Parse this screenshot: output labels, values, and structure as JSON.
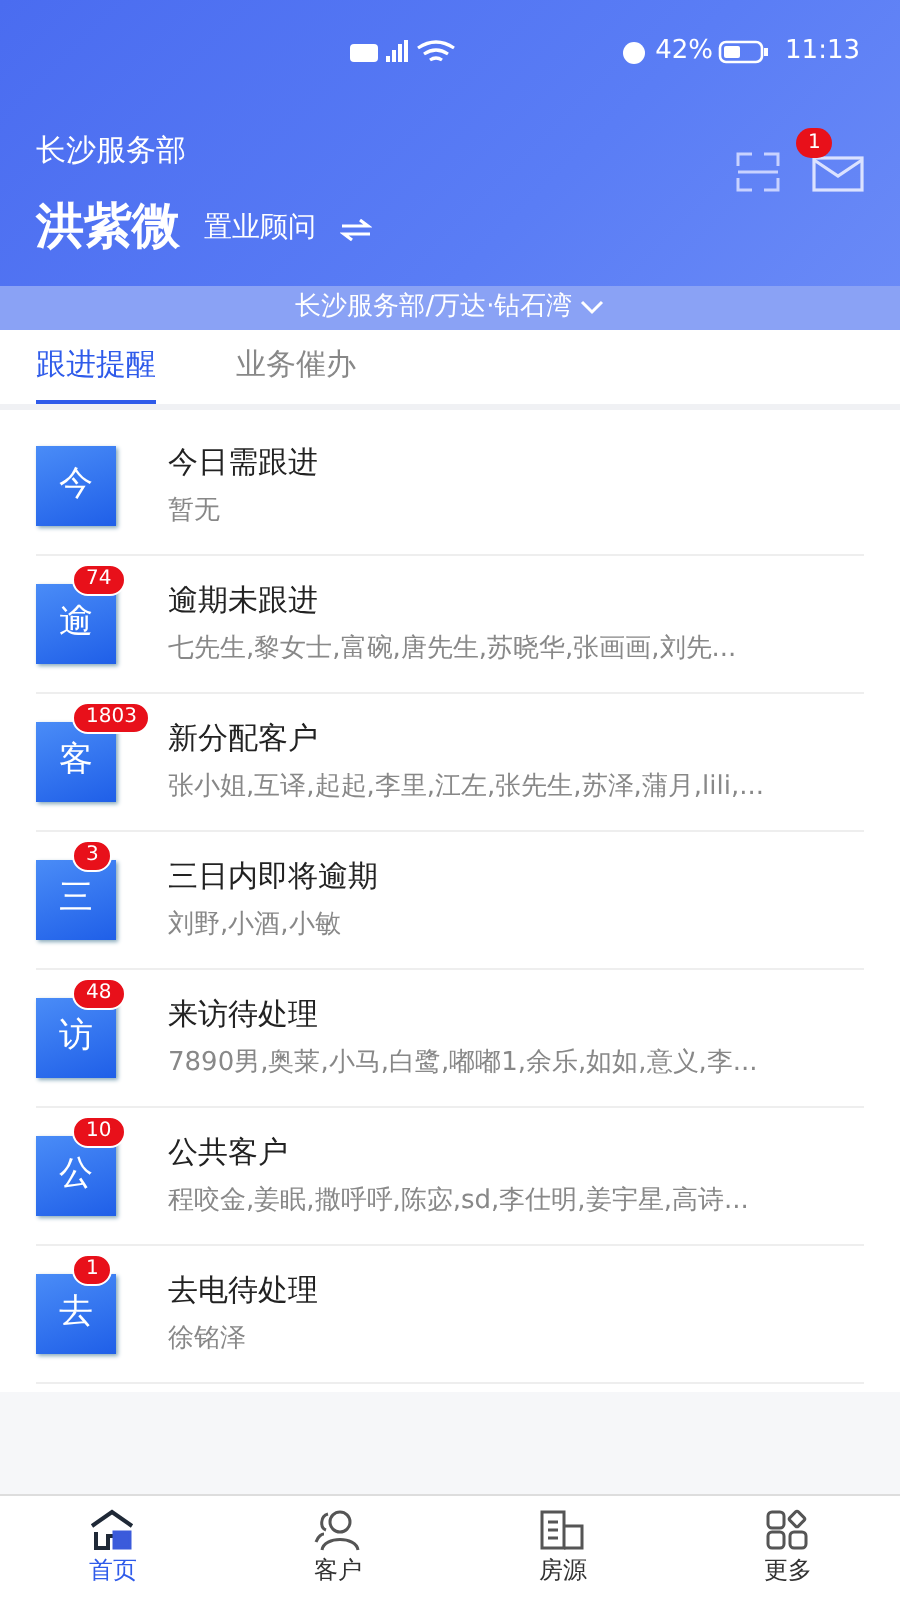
{
  "status_bar": {
    "battery": "42%",
    "time": "11:13"
  },
  "header": {
    "department": "长沙服务部",
    "name": "洪紫微",
    "role": "置业顾问",
    "message_badge": "1",
    "project": "长沙服务部/万达·钻石湾"
  },
  "tabs": [
    {
      "label": "跟进提醒",
      "selected": true
    },
    {
      "label": "业务催办",
      "selected": false
    }
  ],
  "reminders": [
    {
      "icon_char": "今",
      "title": "今日需跟进",
      "subtitle": "暂无"
    },
    {
      "icon_char": "逾",
      "badge": "74",
      "title": "逾期未跟进",
      "subtitle": "七先生,黎女士,富碗,唐先生,苏晓华,张画画,刘先..."
    },
    {
      "icon_char": "客",
      "badge": "1803",
      "title": "新分配客户",
      "subtitle": "张小姐,互译,起起,李里,江左,张先生,苏泽,蒲月,lili,..."
    },
    {
      "icon_char": "三",
      "badge": "3",
      "title": "三日内即将逾期",
      "subtitle": "刘野,小酒,小敏"
    },
    {
      "icon_char": "访",
      "badge": "48",
      "title": "来访待处理",
      "subtitle": "7890男,奥莱,小马,白鹭,嘟嘟1,余乐,如如,意义,李..."
    },
    {
      "icon_char": "公",
      "badge": "10",
      "title": "公共客户",
      "subtitle": "程咬金,姜眠,撒呼呼,陈宓,sd,李仕明,姜宇星,高诗..."
    },
    {
      "icon_char": "去",
      "badge": "1",
      "title": "去电待处理",
      "subtitle": "徐铭泽"
    }
  ],
  "bottom_nav": [
    {
      "kind": "home",
      "label": "首页",
      "selected": true
    },
    {
      "kind": "customers",
      "label": "客户",
      "selected": false
    },
    {
      "kind": "houses",
      "label": "房源",
      "selected": false
    },
    {
      "kind": "more",
      "label": "更多",
      "selected": false
    }
  ]
}
